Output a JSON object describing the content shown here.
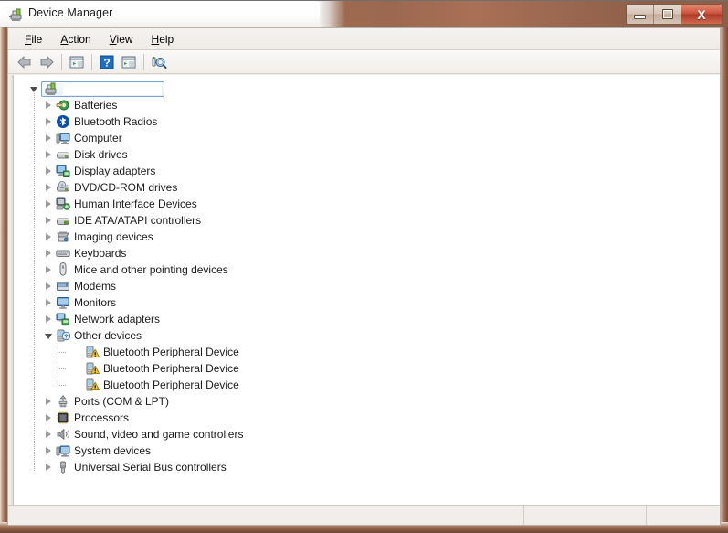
{
  "window": {
    "title": "Device Manager",
    "icon": "device-manager-icon",
    "caption_buttons": [
      {
        "name": "minimize-button",
        "glyph": "minimize-icon",
        "label": "Minimize"
      },
      {
        "name": "maximize-button",
        "glyph": "maximize-icon",
        "label": "Maximize"
      },
      {
        "name": "close-button",
        "glyph": "close-icon",
        "label": "X"
      }
    ],
    "frame_color": "#8a5c45",
    "close_button_color": "#c8503a"
  },
  "menubar": {
    "items": [
      {
        "name": "menu-file",
        "accel": "F",
        "rest": "ile"
      },
      {
        "name": "menu-action",
        "accel": "A",
        "rest": "ction"
      },
      {
        "name": "menu-view",
        "accel": "V",
        "rest": "iew"
      },
      {
        "name": "menu-help",
        "accel": "H",
        "rest": "elp"
      }
    ]
  },
  "toolbar": {
    "buttons": [
      {
        "name": "back-button",
        "icon": "back-arrow-icon",
        "tooltip": "Back"
      },
      {
        "name": "forward-button",
        "icon": "forward-arrow-icon",
        "tooltip": "Forward"
      },
      {
        "name": "show-console-tree-button",
        "icon": "console-tree-icon",
        "tooltip": "Show/Hide Console Tree"
      },
      {
        "name": "help-button",
        "icon": "help-question-icon",
        "tooltip": "Help"
      },
      {
        "name": "properties-button",
        "icon": "properties-icon",
        "tooltip": "Properties"
      },
      {
        "name": "scan-hardware-button",
        "icon": "scan-hardware-changes-icon",
        "tooltip": "Scan for hardware changes"
      }
    ]
  },
  "tree": {
    "root": {
      "name": "tree-root-computer",
      "label": "",
      "icon": "computer-icon",
      "expanded": true,
      "selected": true,
      "label_redacted": true
    },
    "nodes": [
      {
        "label": "Batteries",
        "icon": "batteries-icon",
        "expanded": false,
        "level": 1
      },
      {
        "label": "Bluetooth Radios",
        "icon": "bluetooth-icon",
        "expanded": false,
        "level": 1
      },
      {
        "label": "Computer",
        "icon": "computer-node-icon",
        "expanded": false,
        "level": 1
      },
      {
        "label": "Disk drives",
        "icon": "disk-drive-icon",
        "expanded": false,
        "level": 1
      },
      {
        "label": "Display adapters",
        "icon": "display-adapter-icon",
        "expanded": false,
        "level": 1
      },
      {
        "label": "DVD/CD-ROM drives",
        "icon": "dvd-drive-icon",
        "expanded": false,
        "level": 1
      },
      {
        "label": "Human Interface Devices",
        "icon": "hid-icon",
        "expanded": false,
        "level": 1
      },
      {
        "label": "IDE ATA/ATAPI controllers",
        "icon": "ide-controller-icon",
        "expanded": false,
        "level": 1
      },
      {
        "label": "Imaging devices",
        "icon": "imaging-device-icon",
        "expanded": false,
        "level": 1
      },
      {
        "label": "Keyboards",
        "icon": "keyboard-icon",
        "expanded": false,
        "level": 1
      },
      {
        "label": "Mice and other pointing devices",
        "icon": "mouse-icon",
        "expanded": false,
        "level": 1
      },
      {
        "label": "Modems",
        "icon": "modem-icon",
        "expanded": false,
        "level": 1
      },
      {
        "label": "Monitors",
        "icon": "monitor-icon",
        "expanded": false,
        "level": 1
      },
      {
        "label": "Network adapters",
        "icon": "network-adapter-icon",
        "expanded": false,
        "level": 1
      },
      {
        "label": "Other devices",
        "icon": "other-devices-icon",
        "expanded": true,
        "level": 1
      },
      {
        "label": "Bluetooth Peripheral Device",
        "icon": "unknown-device-warning-icon",
        "expanded": null,
        "level": 2
      },
      {
        "label": "Bluetooth Peripheral Device",
        "icon": "unknown-device-warning-icon",
        "expanded": null,
        "level": 2
      },
      {
        "label": "Bluetooth Peripheral Device",
        "icon": "unknown-device-warning-icon",
        "expanded": null,
        "level": 2
      },
      {
        "label": "Ports (COM & LPT)",
        "icon": "ports-icon",
        "expanded": false,
        "level": 1
      },
      {
        "label": "Processors",
        "icon": "processor-icon",
        "expanded": false,
        "level": 1
      },
      {
        "label": "Sound, video and game controllers",
        "icon": "sound-controller-icon",
        "expanded": false,
        "level": 1
      },
      {
        "label": "System devices",
        "icon": "system-device-icon",
        "expanded": false,
        "level": 1
      },
      {
        "label": "Universal Serial Bus controllers",
        "icon": "usb-controller-icon",
        "expanded": false,
        "level": 1
      }
    ]
  },
  "statusbar": {
    "pane1": "",
    "pane2": "",
    "pane3": ""
  }
}
